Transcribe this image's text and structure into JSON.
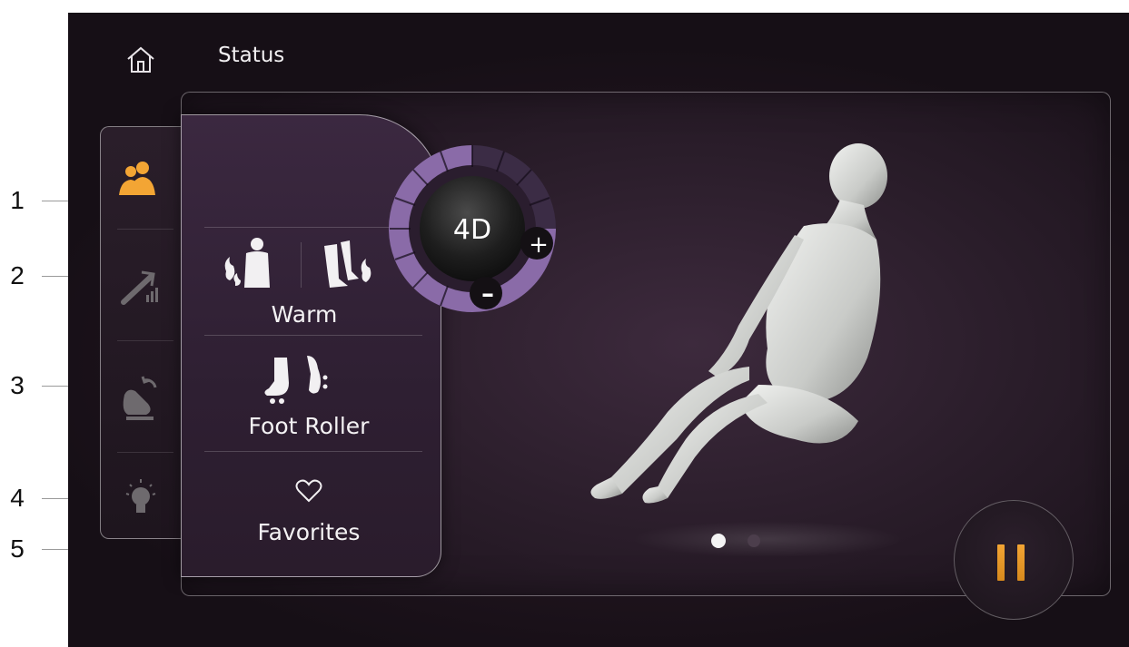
{
  "header": {
    "title": "Status"
  },
  "dial": {
    "mode_label": "4D",
    "plus_label": "+",
    "minus_label": "–"
  },
  "functions": {
    "warm_label": "Warm",
    "foot_roller_label": "Foot Roller",
    "favorites_label": "Favorites"
  },
  "tabs": [
    {
      "name": "users-icon",
      "active": true
    },
    {
      "name": "zero-gravity-icon",
      "active": false
    },
    {
      "name": "recline-icon",
      "active": false
    },
    {
      "name": "light-bulb-icon",
      "active": false
    }
  ],
  "pagination": {
    "pages": 2,
    "current": 1
  },
  "callouts": [
    "1",
    "2",
    "3",
    "4",
    "5"
  ],
  "colors": {
    "accent": "#f3a534",
    "dial_ring": "#8a6ba8",
    "background": "#1c131c"
  }
}
